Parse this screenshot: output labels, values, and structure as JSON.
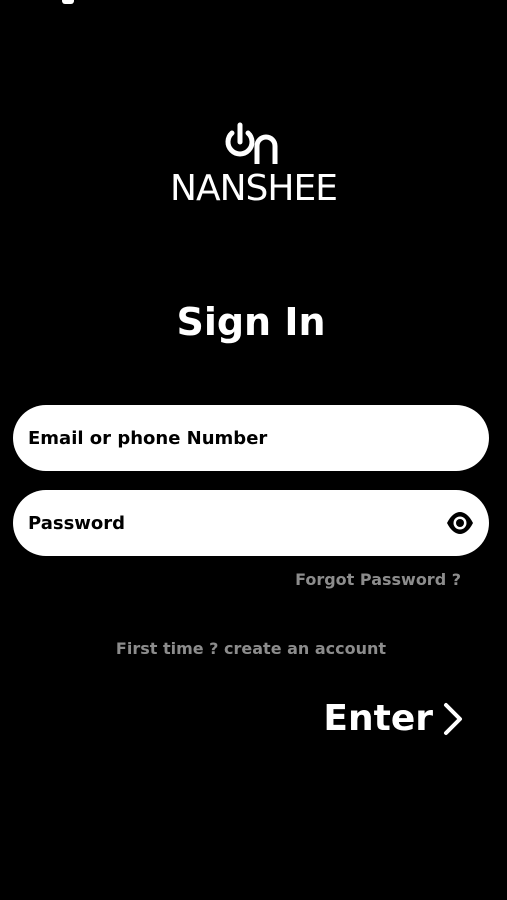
{
  "brand": {
    "mark": "on",
    "name": "NANSHEE"
  },
  "page": {
    "title": "Sign In"
  },
  "form": {
    "email_placeholder": "Email or phone Number",
    "password_placeholder": "Password",
    "forgot_password": "Forgot Password ?",
    "create_account": "First time ? create an account",
    "enter_label": "Enter"
  },
  "colors": {
    "background": "#000000",
    "field_background": "#ffffff",
    "muted_text": "#8c8c8c"
  },
  "icons": {
    "password_toggle": "eye-icon",
    "enter_arrow": "chevron-right-icon"
  }
}
